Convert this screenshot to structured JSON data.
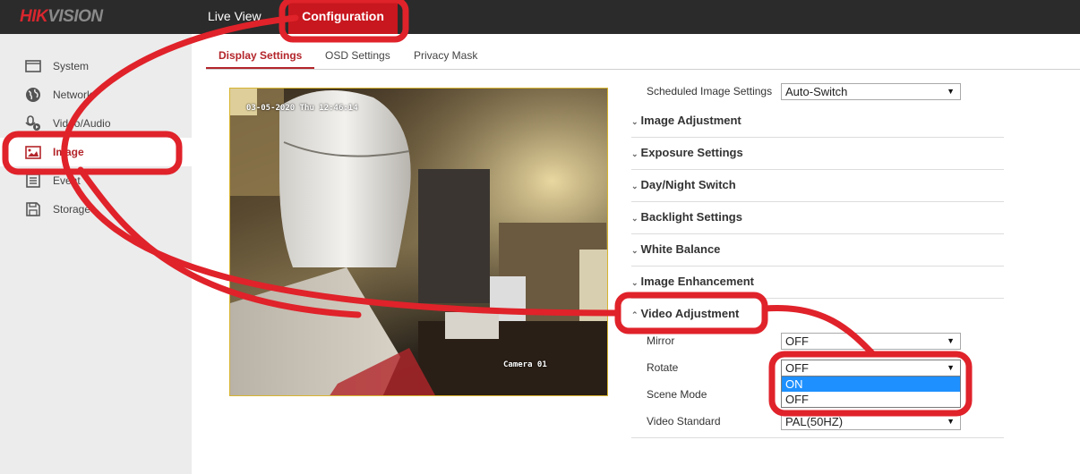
{
  "header": {
    "logo_hik": "HIK",
    "logo_vision": "VISION",
    "nav": [
      {
        "label": "Live View",
        "active": false
      },
      {
        "label": "Configuration",
        "active": true
      }
    ]
  },
  "sidebar": {
    "items": [
      {
        "label": "System",
        "icon": "window-icon",
        "active": false
      },
      {
        "label": "Network",
        "icon": "globe-icon",
        "active": false
      },
      {
        "label": "Video/Audio",
        "icon": "microphone-camera-icon",
        "active": false
      },
      {
        "label": "Image",
        "icon": "image-icon",
        "active": true
      },
      {
        "label": "Event",
        "icon": "list-icon",
        "active": false
      },
      {
        "label": "Storage",
        "icon": "floppy-disk-icon",
        "active": false
      }
    ]
  },
  "tabs": [
    {
      "label": "Display Settings",
      "active": true
    },
    {
      "label": "OSD Settings",
      "active": false
    },
    {
      "label": "Privacy Mask",
      "active": false
    }
  ],
  "video": {
    "timestamp_osd": "03-05-2020 Thu 12:46:14",
    "camera_name_osd": "Camera 01"
  },
  "settings": {
    "scheduled_label": "Scheduled Image Settings",
    "scheduled_value": "Auto-Switch",
    "sections": [
      {
        "title": "Image Adjustment",
        "expanded": false
      },
      {
        "title": "Exposure Settings",
        "expanded": false
      },
      {
        "title": "Day/Night Switch",
        "expanded": false
      },
      {
        "title": "Backlight Settings",
        "expanded": false
      },
      {
        "title": "White Balance",
        "expanded": false
      },
      {
        "title": "Image Enhancement",
        "expanded": false
      },
      {
        "title": "Video Adjustment",
        "expanded": true
      }
    ],
    "video_adjustment": {
      "mirror_label": "Mirror",
      "mirror_value": "OFF",
      "rotate_label": "Rotate",
      "rotate_value": "OFF",
      "rotate_options": [
        "ON",
        "OFF"
      ],
      "rotate_highlighted": "ON",
      "scene_label": "Scene Mode",
      "standard_label": "Video Standard",
      "standard_value": "PAL(50HZ)"
    }
  },
  "colors": {
    "brand_red": "#c8171e",
    "annotation_red": "#e0222a",
    "highlight_blue": "#1e90ff"
  }
}
